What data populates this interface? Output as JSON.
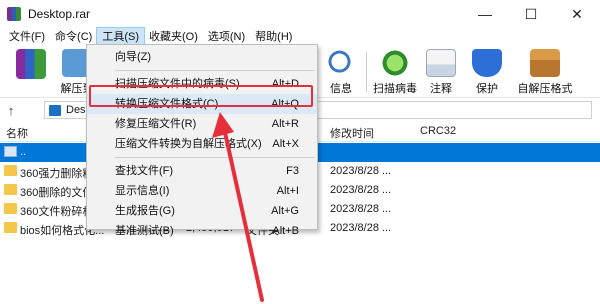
{
  "window": {
    "title": "Desktop.rar",
    "minimize": "—",
    "maximize": "☐",
    "close": "✕"
  },
  "menubar": [
    "文件(F)",
    "命令(C)",
    "工具(S)",
    "收藏夹(O)",
    "选项(N)",
    "帮助(H)"
  ],
  "toolbar": {
    "left_fragment": "解压到",
    "buttons": [
      "信息",
      "扫描病毒",
      "注释",
      "保护",
      "自解压格式"
    ]
  },
  "address": {
    "up_arrow": "↑",
    "path_fragment": "Desk"
  },
  "file_list": {
    "headers": [
      "名称",
      "修改时间",
      "CRC32"
    ],
    "rows": [
      {
        "name": "..",
        "size": "",
        "packed": "",
        "type": "",
        "modified": ""
      },
      {
        "name": "360强力删除粉",
        "size": "",
        "packed": "",
        "type": "",
        "modified": "2023/8/28 ..."
      },
      {
        "name": "360删除的文件",
        "size": "",
        "packed": "",
        "type": "",
        "modified": "2023/8/28 ..."
      },
      {
        "name": "360文件粉碎机",
        "size": "",
        "packed": "",
        "type": "",
        "modified": "2023/8/28 ..."
      },
      {
        "name": "bios如何格式化...",
        "size": "2,450,951",
        "packed": "2,450,917",
        "type": "文件夹",
        "modified": "2023/8/28 ..."
      }
    ]
  },
  "tools_menu": {
    "items": [
      {
        "label": "向导(Z)",
        "shortcut": "",
        "sep_after": true
      },
      {
        "label": "扫描压缩文件中的病毒(S)",
        "shortcut": "Alt+D",
        "sep_after": false
      },
      {
        "label": "转换压缩文件格式(C)",
        "shortcut": "Alt+Q",
        "sep_after": false,
        "highlighted": true
      },
      {
        "label": "修复压缩文件(R)",
        "shortcut": "Alt+R",
        "sep_after": false
      },
      {
        "label": "压缩文件转换为自解压格式(X)",
        "shortcut": "Alt+X",
        "sep_after": true
      },
      {
        "label": "查找文件(F)",
        "shortcut": "F3",
        "sep_after": false
      },
      {
        "label": "显示信息(I)",
        "shortcut": "Alt+I",
        "sep_after": false
      },
      {
        "label": "生成报告(G)",
        "shortcut": "Alt+G",
        "sep_after": false
      },
      {
        "label": "基准测试(B)",
        "shortcut": "Alt+B",
        "sep_after": false
      }
    ]
  },
  "colors": {
    "accent": "#0078d7",
    "highlight_box": "#e5303b",
    "menu_bg": "#f2f2f2"
  }
}
